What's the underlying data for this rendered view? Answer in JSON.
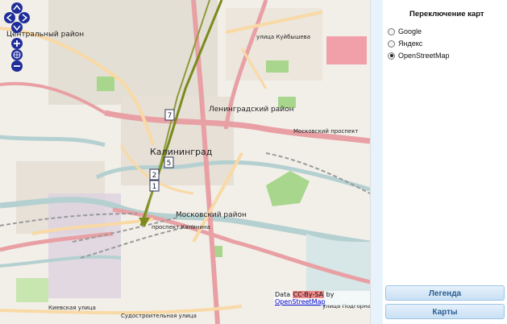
{
  "map": {
    "labels": {
      "central_district": "Центральный район",
      "leningrad_district": "Ленинградский район",
      "kaliningrad": "Калининград",
      "moscow_district": "Московский район",
      "moscow_prospect": "Московский проспект",
      "kalinin_prospect": "проспект Калинина",
      "kievskaya": "Киевская улица",
      "sudostroitelnaya": "Судостроительная улица",
      "podgornaya": "улица Подгорная",
      "kuibysheva": "улица Куйбышева",
      "marker_7": "7",
      "marker_2": "2",
      "marker_1": "1",
      "marker_5": "5"
    },
    "attribution": {
      "prefix": "Data",
      "license": "CC-By-SA",
      "by": "by",
      "source": "OpenStreetMap"
    }
  },
  "panel": {
    "title": "Переключение карт",
    "options": [
      {
        "label": "Google",
        "selected": false
      },
      {
        "label": "Яндекс",
        "selected": false
      },
      {
        "label": "OpenStreetMap",
        "selected": true
      }
    ],
    "legend_button": "Легенда",
    "maps_button": "Карты"
  },
  "colors": {
    "highway": "#e8a0a4",
    "primary_road": "#f9d9a5",
    "water": "#b5d0d0",
    "park": "#a7d68c",
    "railway": "#9a9a9a",
    "route": "#7a8a1c",
    "button_text": "#2a5d91"
  }
}
